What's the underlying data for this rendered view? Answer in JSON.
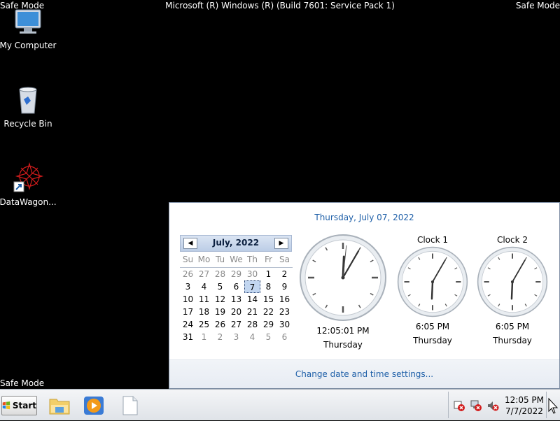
{
  "screen": {
    "safe_mode_label": "Safe Mode",
    "build_text": "Microsoft (R) Windows (R) (Build 7601: Service Pack 1)"
  },
  "desktop": {
    "icons": [
      {
        "label": "My Computer",
        "icon": "computer-icon"
      },
      {
        "label": "Recycle Bin",
        "icon": "recycle-bin-icon"
      },
      {
        "label": "DataWagon...",
        "icon": "datawagon-shortcut-icon"
      }
    ]
  },
  "flyout": {
    "date_long": "Thursday, July 07, 2022",
    "footer_link": "Change date and time settings...",
    "calendar": {
      "title": "July, 2022",
      "prev_glyph": "◀",
      "next_glyph": "▶",
      "day_headers": [
        "Su",
        "Mo",
        "Tu",
        "We",
        "Th",
        "Fr",
        "Sa"
      ],
      "weeks": [
        [
          "26",
          "27",
          "28",
          "29",
          "30",
          "1",
          "2"
        ],
        [
          "3",
          "4",
          "5",
          "6",
          "7",
          "8",
          "9"
        ],
        [
          "10",
          "11",
          "12",
          "13",
          "14",
          "15",
          "16"
        ],
        [
          "17",
          "18",
          "19",
          "20",
          "21",
          "22",
          "23"
        ],
        [
          "24",
          "25",
          "26",
          "27",
          "28",
          "29",
          "30"
        ],
        [
          "31",
          "1",
          "2",
          "3",
          "4",
          "5",
          "6"
        ]
      ],
      "today": "7"
    },
    "clocks": [
      {
        "name": "",
        "time": "12:05:01 PM",
        "day": "Thursday"
      },
      {
        "name": "Clock 1",
        "time": "6:05 PM",
        "day": "Thursday"
      },
      {
        "name": "Clock 2",
        "time": "6:05 PM",
        "day": "Thursday"
      }
    ]
  },
  "taskbar": {
    "start_label": "Start",
    "pinned": [
      "windows-explorer-icon",
      "media-player-icon",
      "blank-document-icon"
    ],
    "tray_icons": [
      "action-center-icon",
      "network-disconnected-icon",
      "volume-muted-icon"
    ],
    "tray_time": "12:05 PM",
    "tray_date": "7/7/2022"
  }
}
